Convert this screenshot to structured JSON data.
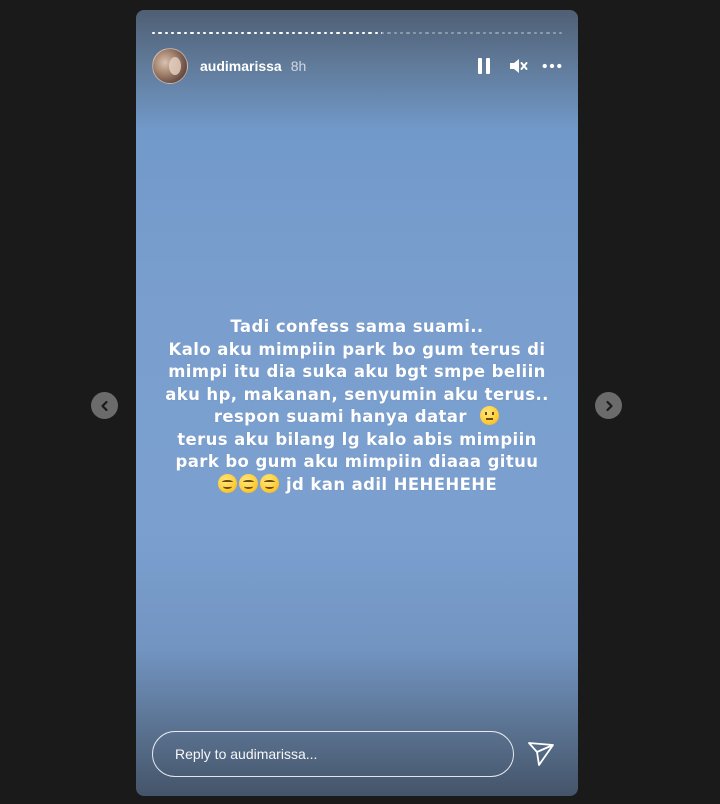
{
  "story": {
    "progress": [
      1,
      1,
      1,
      1,
      1,
      1,
      1,
      1,
      1,
      1,
      1,
      1,
      1,
      1,
      1,
      1,
      1,
      1,
      1,
      1,
      1,
      1,
      1,
      1,
      1,
      1,
      1,
      1,
      1,
      1,
      1,
      1,
      1,
      1,
      1,
      1,
      0.3,
      0,
      0,
      0,
      0,
      0,
      0,
      0,
      0,
      0,
      0,
      0,
      0,
      0,
      0,
      0,
      0,
      0,
      0,
      0,
      0,
      0,
      0,
      0,
      0,
      0,
      0,
      0,
      0
    ],
    "header": {
      "avatar_icon": "profile-avatar",
      "username": "audimarissa",
      "time": "8h",
      "controls": [
        "pause-icon",
        "muted-speaker-icon",
        "more-options-icon"
      ]
    },
    "caption": {
      "line1": "Tadi confess sama suami..",
      "line2": "Kalo aku mimpiin park bo gum terus di",
      "line3": "mimpi itu dia suka aku bgt smpe beliin",
      "line4": "aku hp, makanan, senyumin aku terus..",
      "line5_text": "respon suami hanya datar",
      "line5_emoji": "neutral-face-emoji",
      "line6": "terus aku bilang lg kalo abis mimpiin",
      "line7": "park bo gum aku mimpiin diaaa gituu",
      "line8_emoji": "smiling-face-emoji x3",
      "line8_text": "jd kan adil HEHEHEHE"
    },
    "reply": {
      "placeholder": "Reply to audimarissa...",
      "send_icon": "send-icon"
    }
  },
  "navigation": {
    "prev_icon": "chevron-left-icon",
    "next_icon": "chevron-right-icon"
  },
  "colors": {
    "page_background": "#1a1a1a",
    "story_background": "#7ba0d0",
    "text": "#ffffff",
    "nav_button": "#6b6b6b"
  }
}
